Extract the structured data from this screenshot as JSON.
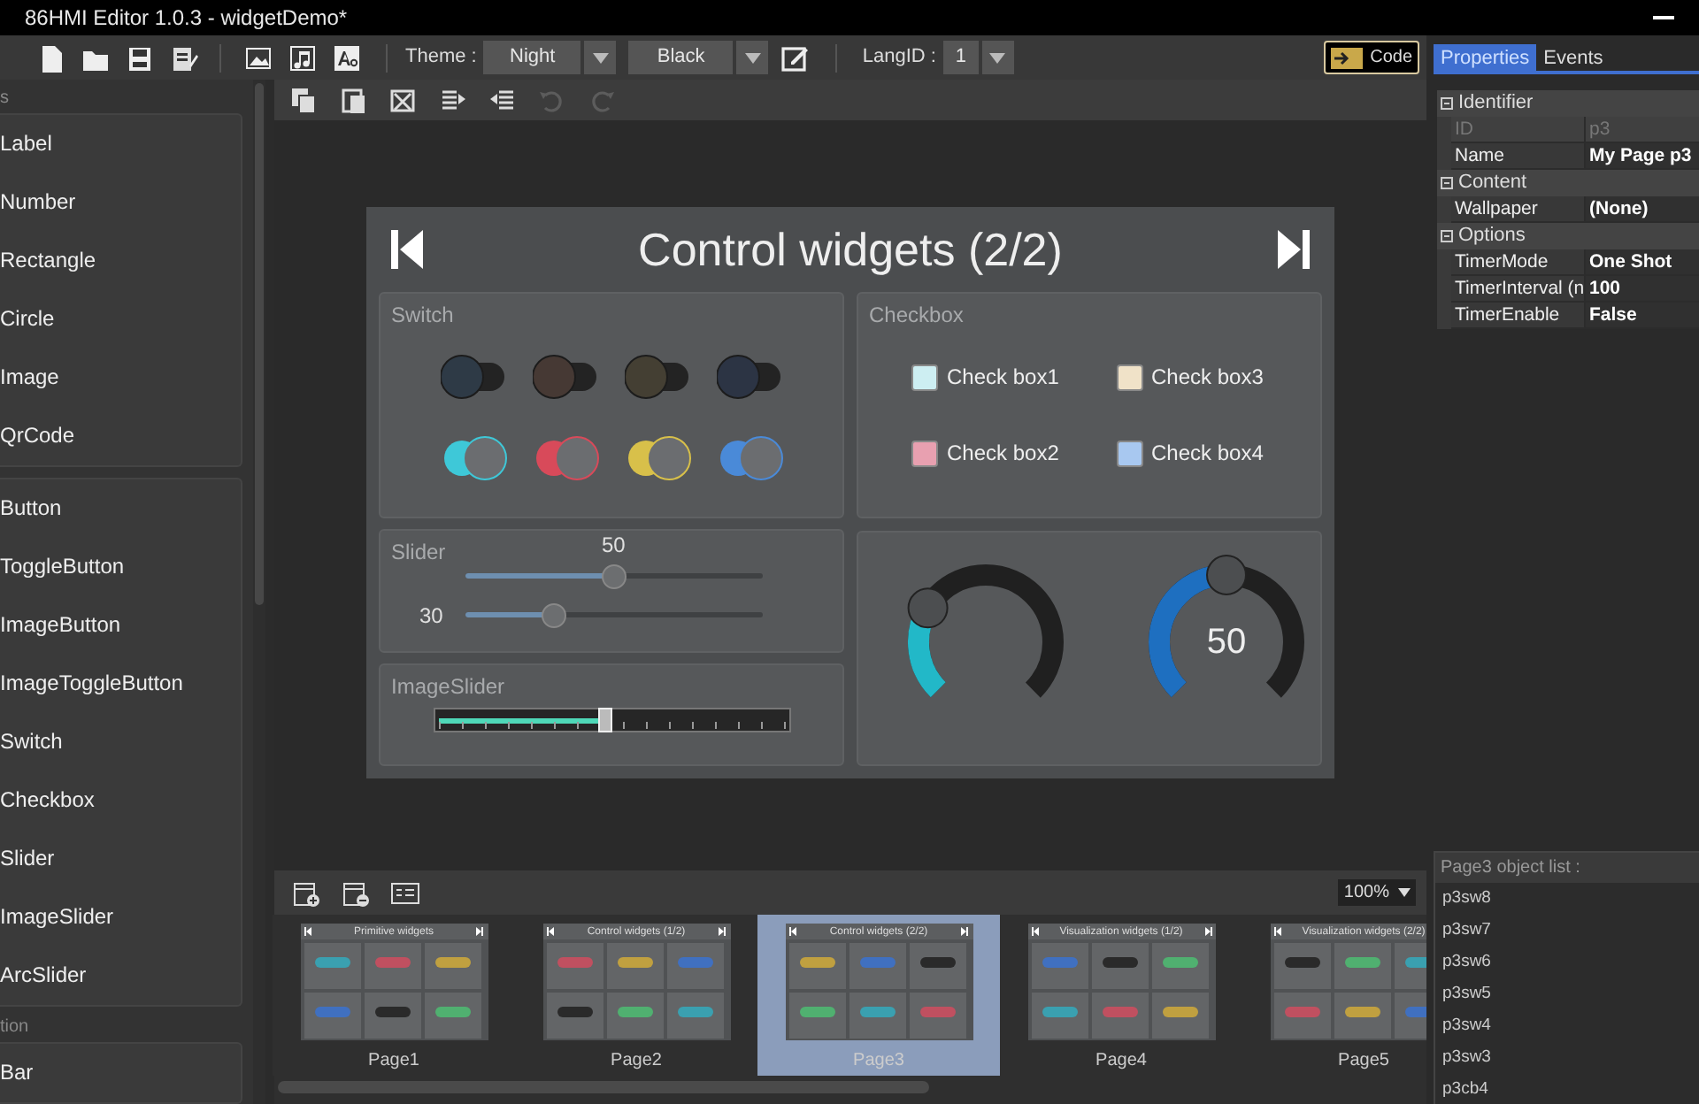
{
  "window": {
    "title": "86HMI Editor 1.0.3 - widgetDemo*"
  },
  "toolbar": {
    "tools": [
      {
        "kind": "new"
      },
      {
        "kind": "open"
      },
      {
        "kind": "save"
      },
      {
        "kind": "save_as"
      },
      {
        "kind": "sep"
      },
      {
        "kind": "image"
      },
      {
        "kind": "sound"
      },
      {
        "kind": "font"
      }
    ],
    "theme_label": "Theme :",
    "theme": "Night",
    "color_scheme": "Black",
    "langid_label": "LangID :",
    "langid": "1",
    "code_button": "Code"
  },
  "side_tabs": [
    {
      "label": "Properties",
      "selected": true
    },
    {
      "label": "Events",
      "selected": false
    }
  ],
  "widget_groups": [
    {
      "title": "s",
      "items": [
        "Label",
        "Number",
        "Rectangle",
        "Circle",
        "Image",
        "QrCode"
      ]
    },
    {
      "items": [
        "Button",
        "ToggleButton",
        "ImageButton",
        "ImageToggleButton",
        "Switch",
        "Checkbox",
        "Slider",
        "ImageSlider",
        "ArcSlider"
      ]
    },
    {
      "title": "tion",
      "items": [
        "Bar"
      ]
    }
  ],
  "edit_tools": [
    {
      "kind": "copy",
      "disabled": false
    },
    {
      "kind": "paste",
      "disabled": false
    },
    {
      "kind": "delete",
      "disabled": false
    },
    {
      "kind": "forward",
      "disabled": false
    },
    {
      "kind": "backward",
      "disabled": false
    },
    {
      "kind": "undo",
      "disabled": true
    },
    {
      "kind": "redo",
      "disabled": true
    }
  ],
  "design_page": {
    "title": "Control widgets (2/2)",
    "switch_panel": {
      "title": "Switch",
      "switches": [
        {
          "color": "#2e3a46",
          "on": false
        },
        {
          "color": "#463934",
          "on": false
        },
        {
          "color": "#443f33",
          "on": false
        },
        {
          "color": "#2c3444",
          "on": false
        }
      ],
      "leds": [
        {
          "color": "#3ec8d8"
        },
        {
          "color": "#d84a5a"
        },
        {
          "color": "#d8c04a"
        },
        {
          "color": "#4a8ad8"
        }
      ]
    },
    "checkbox_panel": {
      "title": "Checkbox",
      "items": [
        {
          "label": "Check box1",
          "color": "#cdeef2",
          "checked": false
        },
        {
          "label": "Check box3",
          "color": "#f0e2c8",
          "checked": false
        },
        {
          "label": "Check box2",
          "color": "#e8a0b0",
          "checked": false
        },
        {
          "label": "Check box4",
          "color": "#a8c8f0",
          "checked": false
        }
      ]
    },
    "slider_panel": {
      "title": "Slider",
      "sliders": [
        {
          "kind": "value_above",
          "level": 0.5,
          "reading": "50"
        },
        {
          "kind": "value_left",
          "level": 0.3,
          "reading": "30"
        }
      ]
    },
    "image_slider_panel": {
      "title": "ImageSlider",
      "level": 0.48
    },
    "arc_panel": {
      "arcs": [
        {
          "level": 0.28,
          "color": "#22b8c8"
        },
        {
          "level": 0.5,
          "color": "#1e6fc0",
          "reading": "50"
        }
      ]
    }
  },
  "page_tools": [
    {
      "kind": "add_page"
    },
    {
      "kind": "remove_page"
    },
    {
      "kind": "page_list"
    }
  ],
  "zoom": "100%",
  "pages": [
    {
      "title": "Primitive widgets",
      "caption": "Page1",
      "selected": false
    },
    {
      "title": "Control widgets (1/2)",
      "caption": "Page2",
      "selected": false
    },
    {
      "title": "Control widgets (2/2)",
      "caption": "Page3",
      "selected": true
    },
    {
      "title": "Visualization widgets (1/2)",
      "caption": "Page4",
      "selected": false
    },
    {
      "title": "Visualization widgets (2/2)",
      "caption": "Page5",
      "selected": false
    }
  ],
  "properties": [
    {
      "title": "Identifier",
      "rows": [
        {
          "name": "ID",
          "value": "p3",
          "disabled": true
        },
        {
          "name": "Name",
          "value": "My Page p3",
          "disabled": false
        }
      ]
    },
    {
      "title": "Content",
      "rows": [
        {
          "name": "Wallpaper",
          "value": "(None)",
          "disabled": false
        }
      ]
    },
    {
      "title": "Options",
      "rows": [
        {
          "name": "TimerMode",
          "value": "One Shot",
          "disabled": false
        },
        {
          "name": "TimerInterval (n",
          "value": "100",
          "disabled": false
        },
        {
          "name": "TimerEnable",
          "value": "False",
          "disabled": false
        }
      ]
    }
  ],
  "object_list": {
    "title": "Page3 object list :",
    "items": [
      "p3sw8",
      "p3sw7",
      "p3sw6",
      "p3sw5",
      "p3sw4",
      "p3sw3",
      "p3cb4"
    ]
  }
}
